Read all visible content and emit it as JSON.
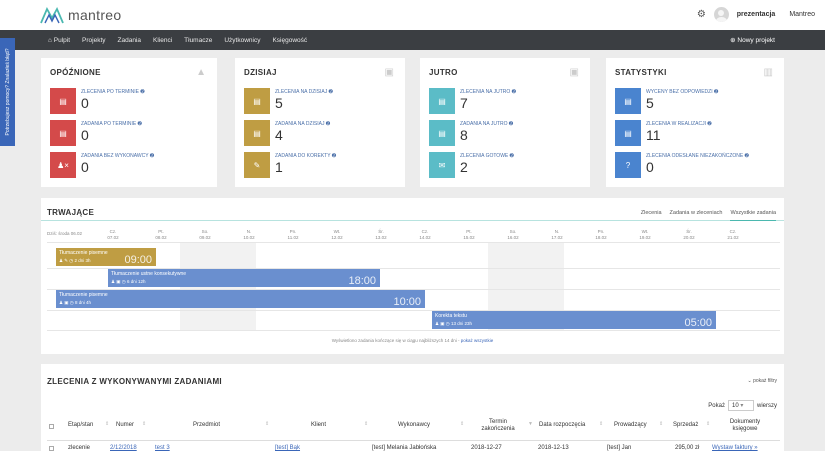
{
  "brand": {
    "name": "mantreo"
  },
  "header": {
    "user_name": "prezentacja",
    "org_name": "Mantreo"
  },
  "nav": {
    "items": [
      "Pulpit",
      "Projekty",
      "Zadania",
      "Klienci",
      "Tłumacze",
      "Użytkownicy",
      "Księgowość"
    ],
    "new_project": "Nowy projekt"
  },
  "side_tab": "Potrzebujesz pomocy? Znalazłeś błąd?",
  "cards": [
    {
      "title": "OPÓŹNIONE",
      "icon": "warning-icon",
      "stats": [
        {
          "label": "ZLECENIA PO TERMINIE",
          "value": "0",
          "color": "#d44a4a",
          "icon": "list-icon"
        },
        {
          "label": "ZADANIA PO TERMINIE",
          "value": "0",
          "color": "#d44a4a",
          "icon": "list-icon"
        },
        {
          "label": "ZADANIA BEZ WYKONAWCY",
          "value": "0",
          "color": "#d44a4a",
          "icon": "user-remove-icon"
        }
      ]
    },
    {
      "title": "DZISIAJ",
      "icon": "calendar-icon",
      "stats": [
        {
          "label": "ZLECENIA NA DZISIAJ",
          "value": "5",
          "color": "#bf9d43",
          "icon": "list-icon"
        },
        {
          "label": "ZADANIA NA DZISIAJ",
          "value": "4",
          "color": "#bf9d43",
          "icon": "list-icon"
        },
        {
          "label": "ZADANIA DO KOREKTY",
          "value": "1",
          "color": "#bf9d43",
          "icon": "edit-icon"
        }
      ]
    },
    {
      "title": "JUTRO",
      "icon": "calendar-icon",
      "stats": [
        {
          "label": "ZLECENIA NA JUTRO",
          "value": "7",
          "color": "#5bbcc7",
          "icon": "list-icon"
        },
        {
          "label": "ZADANIA NA JUTRO",
          "value": "8",
          "color": "#5bbcc7",
          "icon": "list-icon"
        },
        {
          "label": "ZLECENIA GOTOWE",
          "value": "2",
          "color": "#5bbcc7",
          "icon": "mail-icon"
        }
      ]
    },
    {
      "title": "STATYSTYKI",
      "icon": "bar-chart-icon",
      "stats": [
        {
          "label": "WYCENY BEZ ODPOWIEDZI",
          "value": "5",
          "color": "#4a84cf",
          "icon": "list-icon"
        },
        {
          "label": "ZLECENIA W REALIZACJI",
          "value": "11",
          "color": "#4a84cf",
          "icon": "list-icon"
        },
        {
          "label": "ZLECENIA ODESŁANE NIEZAKOŃCZONE",
          "value": "0",
          "color": "#4a84cf",
          "icon": "question-icon"
        }
      ]
    }
  ],
  "timeline": {
    "title": "TRWAJĄCE",
    "tabs": [
      "Zlecenia",
      "Zadania w zleceniach",
      "Wszystkie zadania"
    ],
    "today_label": "Dziś: środa 06.02",
    "days": [
      {
        "dow": "Cz.",
        "date": "07.02"
      },
      {
        "dow": "Pt.",
        "date": "08.02"
      },
      {
        "dow": "So.",
        "date": "09.02"
      },
      {
        "dow": "N.",
        "date": "10.02"
      },
      {
        "dow": "Pn.",
        "date": "11.02"
      },
      {
        "dow": "Wt.",
        "date": "12.02"
      },
      {
        "dow": "Śr.",
        "date": "13.02"
      },
      {
        "dow": "Cz.",
        "date": "14.02"
      },
      {
        "dow": "Pt.",
        "date": "15.02"
      },
      {
        "dow": "So.",
        "date": "16.02"
      },
      {
        "dow": "N.",
        "date": "17.02"
      },
      {
        "dow": "Pn.",
        "date": "18.02"
      },
      {
        "dow": "Wt.",
        "date": "19.02"
      },
      {
        "dow": "Śr.",
        "date": "20.02"
      },
      {
        "dow": "Cz.",
        "date": "21.02"
      }
    ],
    "bars": [
      {
        "title": "Tłumaczenie pisemne",
        "meta": "2 dni 3h",
        "time": "09:00",
        "color": "#bf9d43"
      },
      {
        "title": "Tłumaczenie ustne konsekutywne",
        "meta": "6 dni 12h",
        "time": "18:00",
        "color": "#6a8fcf"
      },
      {
        "title": "Tłumaczenie pisemne",
        "meta": "8 dni 4h",
        "time": "10:00",
        "color": "#6a8fcf"
      },
      {
        "title": "Korekta tekstu",
        "meta": "13 dni 23h",
        "time": "05:00",
        "color": "#6a8fcf"
      }
    ],
    "footer_text": "Wyświetlono zadania kończące się w ciągu najbliższych 14 dni -",
    "footer_link": "pokaż wszystkie"
  },
  "orders_table": {
    "title": "ZLECENIA Z WYKONYWANYMI ZADANIAMI",
    "filter_label": "pokaż filtry",
    "show_label": "Pokaż",
    "show_value": "10",
    "rows_label": "wierszy",
    "columns": [
      "Etap/stan",
      "Numer",
      "Przedmiot",
      "Klient",
      "Wykonawcy",
      "Termin zakończenia",
      "Data rozpoczęcia",
      "Prowadzący",
      "Sprzedaż",
      "Dokumenty księgowe"
    ],
    "rows": [
      {
        "stage": "zlecenie",
        "number": "2/12/2018",
        "subject": "test 3",
        "client": "[test] Bąk",
        "performers": "[test] Melania Jabłońska",
        "deadline": "2018-12-27",
        "start": "2018-12-13",
        "manager": "[test] Jan",
        "sales": "295,00 zł",
        "docs": "Wystaw faktury »"
      }
    ]
  }
}
